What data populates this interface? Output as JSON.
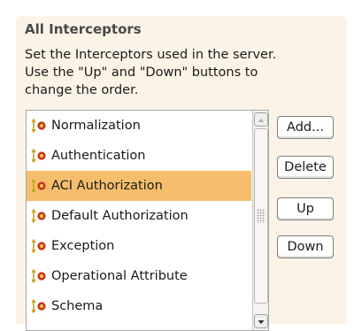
{
  "section": {
    "title": "All Interceptors",
    "description_lines": [
      "Set the Interceptors used in the server.",
      "Use the \"Up\" and \"Down\" buttons to",
      "change the order."
    ]
  },
  "interceptors": {
    "items": [
      {
        "label": "Normalization",
        "icon": "interceptor-icon"
      },
      {
        "label": "Authentication",
        "icon": "interceptor-icon"
      },
      {
        "label": "ACI Authorization",
        "icon": "interceptor-icon",
        "selected": true
      },
      {
        "label": "Default Authorization",
        "icon": "interceptor-icon"
      },
      {
        "label": "Exception",
        "icon": "interceptor-icon"
      },
      {
        "label": "Operational Attribute",
        "icon": "interceptor-icon"
      },
      {
        "label": "Schema",
        "icon": "interceptor-icon"
      }
    ],
    "selected_color": "#f6be6c"
  },
  "buttons": {
    "add": "Add...",
    "delete": "Delete",
    "up": "Up",
    "down": "Down"
  }
}
